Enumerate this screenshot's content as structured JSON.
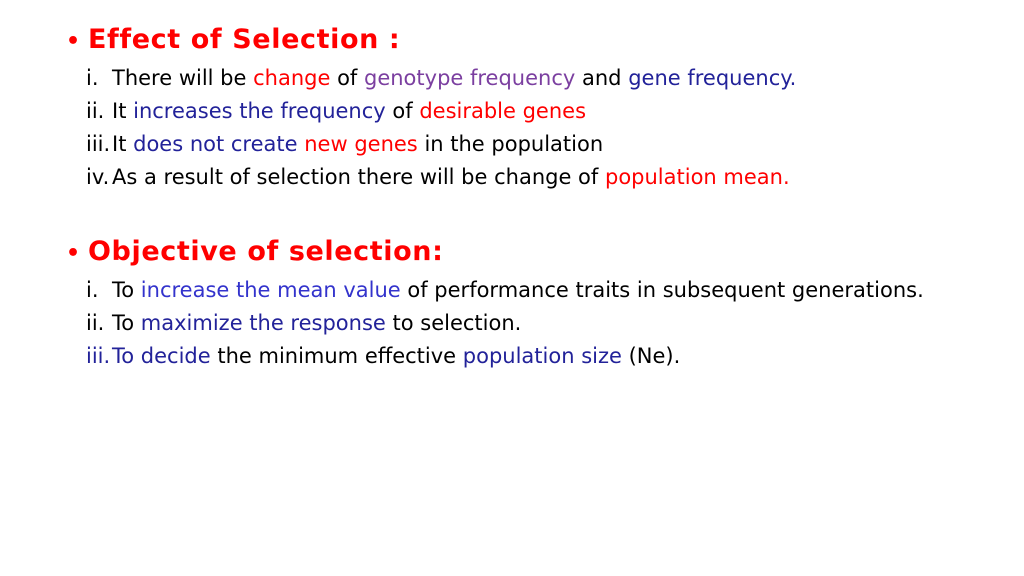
{
  "slide": {
    "background_color": "#FFFFFF",
    "colors": {
      "red": "#FF0000",
      "purple": "#7B3FA0",
      "navy": "#222299",
      "blue": "#3333CC",
      "black": "#000000"
    },
    "bullet_glyph": "•",
    "sections": [
      {
        "id": "effect-of-selection",
        "heading": "Effect of Selection :",
        "heading_color": "#FF0000",
        "items": [
          {
            "marker": "i.",
            "marker_color": "#000000",
            "layout": "tight",
            "runs": [
              {
                "text": "There will be ",
                "color": "#000000"
              },
              {
                "text": "change",
                "color": "#FF0000"
              },
              {
                "text": " of ",
                "color": "#000000"
              },
              {
                "text": "genotype frequency",
                "color": "#7B3FA0"
              },
              {
                "text": " and ",
                "color": "#000000"
              },
              {
                "text": "gene frequency.",
                "color": "#222299"
              }
            ]
          },
          {
            "marker": "ii.",
            "marker_color": "#000000",
            "layout": "tight",
            "runs": [
              {
                "text": "It ",
                "color": "#000000"
              },
              {
                "text": "increases the frequency",
                "color": "#222299"
              },
              {
                "text": " of ",
                "color": "#000000"
              },
              {
                "text": "desirable genes",
                "color": "#FF0000"
              }
            ]
          },
          {
            "marker": "iii.",
            "marker_color": "#000000",
            "layout": "tight",
            "runs": [
              {
                "text": "It ",
                "color": "#000000"
              },
              {
                "text": "does not create",
                "color": "#222299"
              },
              {
                "text": " ",
                "color": "#000000"
              },
              {
                "text": "new genes",
                "color": "#FF0000"
              },
              {
                "text": " in the population",
                "color": "#000000"
              }
            ]
          },
          {
            "marker": "iv.",
            "marker_color": "#000000",
            "layout": "tight",
            "runs": [
              {
                "text": "As a result of selection there will be change of ",
                "color": "#000000"
              },
              {
                "text": "population mean.",
                "color": "#FF0000"
              }
            ]
          }
        ]
      },
      {
        "id": "objective-of-selection",
        "heading": "Objective of selection:",
        "heading_color": "#FF0000",
        "items": [
          {
            "marker": "i.",
            "marker_color": "#000000",
            "layout": "justify",
            "runs": [
              {
                "text": "To ",
                "color": "#000000"
              },
              {
                "text": "increase the mean value",
                "color": "#3333CC"
              },
              {
                "text": " of performance traits in subsequent generations.",
                "color": "#000000"
              }
            ]
          },
          {
            "marker": "ii.",
            "marker_color": "#000000",
            "layout": "tight",
            "runs": [
              {
                "text": "To ",
                "color": "#000000"
              },
              {
                "text": "maximize the response",
                "color": "#222299"
              },
              {
                "text": " to selection.",
                "color": "#000000"
              }
            ]
          },
          {
            "marker": "iii.",
            "marker_color": "#222299",
            "layout": "tight",
            "runs": [
              {
                "text": "To decide",
                "color": "#222299"
              },
              {
                "text": " the minimum effective ",
                "color": "#000000"
              },
              {
                "text": "population size",
                "color": "#222299"
              },
              {
                "text": " (Ne).",
                "color": "#000000"
              }
            ]
          }
        ]
      }
    ]
  }
}
